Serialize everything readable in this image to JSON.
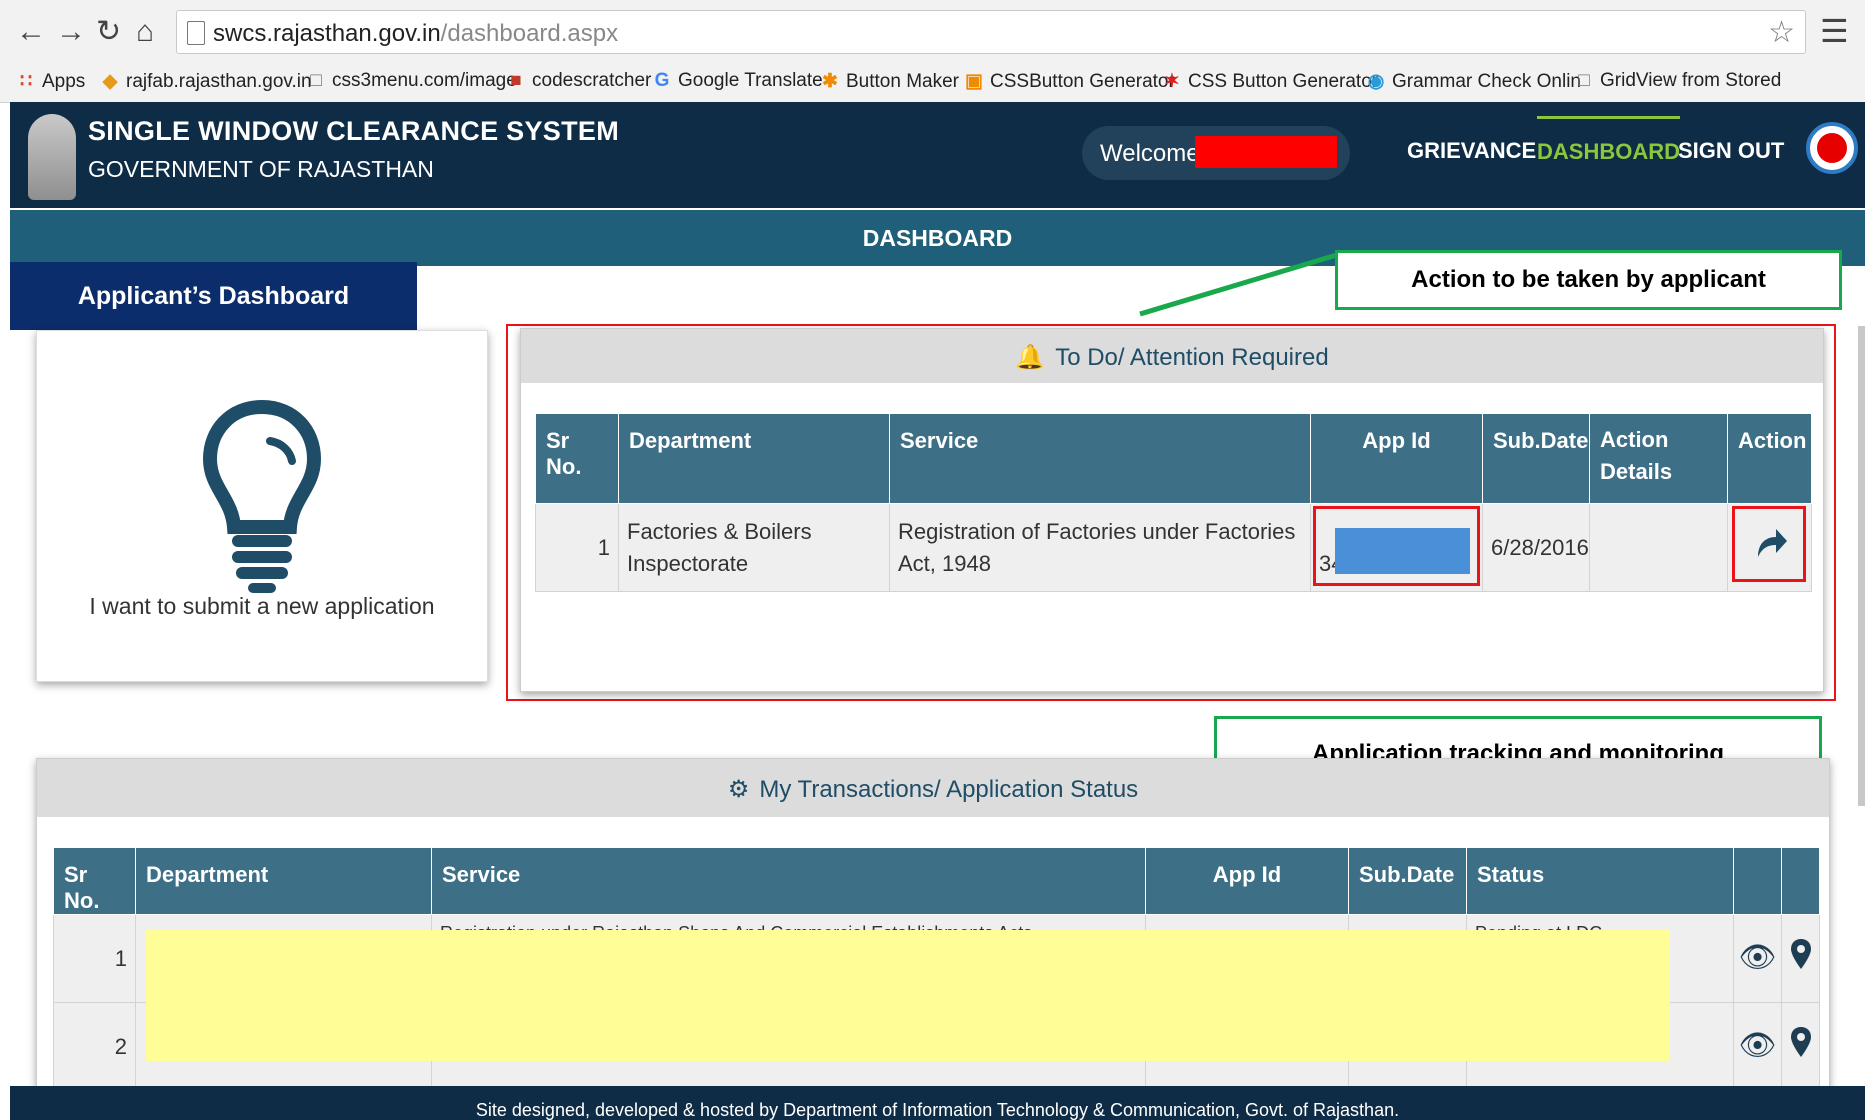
{
  "browser": {
    "url_host": "swcs.rajasthan.gov.in",
    "url_path": "/dashboard.aspx",
    "bookmarks": [
      {
        "label": "Apps",
        "icon": "apps-grid-icon"
      },
      {
        "label": "rajfab.rajasthan.gov.in",
        "icon": "site-favicon-icon"
      },
      {
        "label": "css3menu.com/image",
        "icon": "page-icon"
      },
      {
        "label": "codescratcher",
        "icon": "site-favicon-icon"
      },
      {
        "label": "Google Translate",
        "icon": "translate-icon"
      },
      {
        "label": "Button Maker",
        "icon": "asterisk-icon"
      },
      {
        "label": "CSSButton Generator",
        "icon": "css-icon"
      },
      {
        "label": "CSS Button Generator",
        "icon": "star-burst-icon"
      },
      {
        "label": "Grammar Check Onlin",
        "icon": "check-circle-icon"
      },
      {
        "label": "GridView from Stored",
        "icon": "page-icon"
      }
    ]
  },
  "header": {
    "title": "SINGLE WINDOW CLEARANCE SYSTEM",
    "subtitle": "GOVERNMENT OF RAJASTHAN",
    "welcome": "Welcome M",
    "nav": [
      "GRIEVANCE",
      "DASHBOARD",
      "SIGN OUT"
    ],
    "active_nav": "DASHBOARD"
  },
  "page_title": "DASHBOARD",
  "applicant_label": "Applicant’s Dashboard",
  "new_application": "I want to submit a new application",
  "callouts": {
    "action": "Action to be taken by applicant",
    "tracking": "Application tracking and monitoring Dashboard by applicant"
  },
  "todo": {
    "heading": "To Do/ Attention Required",
    "columns": [
      "Sr No.",
      "Department",
      "Service",
      "App Id",
      "Sub.Date",
      "Action Details",
      "Action"
    ],
    "rows": [
      {
        "sr": "1",
        "department": "Factories & Boilers Inspectorate",
        "service": "Registration of Factories under Factories Act, 1948",
        "app_id": "34",
        "sub_date": "6/28/2016",
        "action_details": ""
      }
    ]
  },
  "transactions": {
    "heading": "My Transactions/ Application Status",
    "columns": [
      "Sr No.",
      "Department",
      "Service",
      "App Id",
      "Sub.Date",
      "Status"
    ],
    "rows": [
      {
        "sr": "1",
        "department": "",
        "service": "Registration under Rajasthan Shops And Commercial Establishments Acts",
        "app_id": "",
        "sub_date": "",
        "status": "Pending at LDC"
      },
      {
        "sr": "2",
        "department": "",
        "service": "",
        "app_id": "",
        "sub_date": "",
        "status": ""
      }
    ]
  },
  "footer": "Site designed, developed & hosted by Department of Information Technology & Communication, Govt. of Rajasthan.",
  "colors": {
    "header_bg": "#0e2c45",
    "bar_bg": "#1f5f7a",
    "table_head": "#3d6f86",
    "active_nav": "#8cc63f",
    "callout_border": "#19a84b",
    "highlight_red": "#e8141a"
  }
}
